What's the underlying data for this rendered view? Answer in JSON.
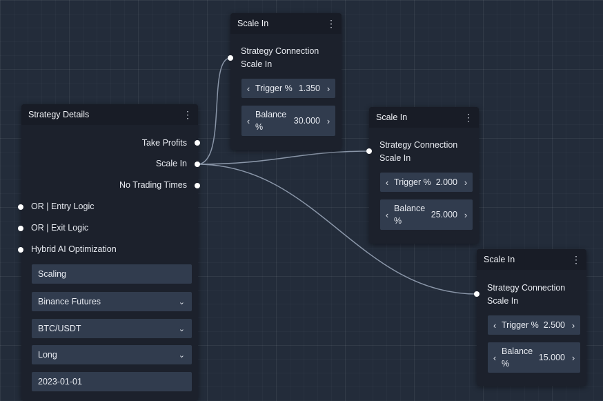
{
  "colors": {
    "canvas": "#232c3a",
    "node": "#1c212c",
    "field": "#313c4e",
    "wire": "#8a96a8",
    "port": "#ffffff"
  },
  "strategy": {
    "title": "Strategy Details",
    "menu_icon": "⋮",
    "outputs": [
      "Take Profits",
      "Scale In",
      "No Trading Times"
    ],
    "inputs": [
      "OR | Entry Logic",
      "OR | Exit Logic",
      "Hybrid AI Optimization"
    ],
    "name_value": "Scaling",
    "exchange": "Binance Futures",
    "pair": "BTC/USDT",
    "direction": "Long",
    "start_date": "2023-01-01"
  },
  "scale_nodes": [
    {
      "title": "Scale In",
      "menu_icon": "⋮",
      "connection_line1": "Strategy Connection",
      "connection_line2": "Scale In",
      "trigger_label": "Trigger %",
      "trigger_value": "1.350",
      "balance_label": "Balance %",
      "balance_value": "30.000"
    },
    {
      "title": "Scale In",
      "menu_icon": "⋮",
      "connection_line1": "Strategy Connection",
      "connection_line2": "Scale In",
      "trigger_label": "Trigger %",
      "trigger_value": "2.000",
      "balance_label": "Balance %",
      "balance_value": "25.000"
    },
    {
      "title": "Scale In",
      "menu_icon": "⋮",
      "connection_line1": "Strategy Connection",
      "connection_line2": "Scale In",
      "trigger_label": "Trigger %",
      "trigger_value": "2.500",
      "balance_label": "Balance %",
      "balance_value": "15.000"
    }
  ],
  "icons": {
    "left": "‹",
    "right": "›",
    "dropdown": "⌄"
  }
}
